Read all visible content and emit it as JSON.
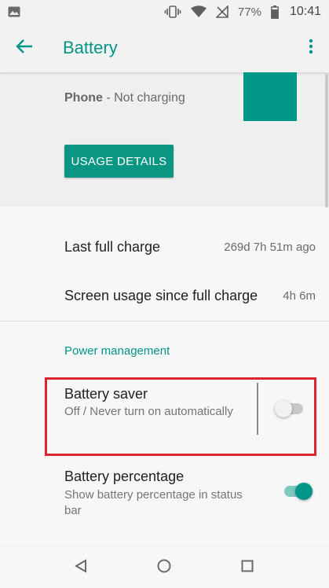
{
  "status_bar": {
    "battery_percent": "77%",
    "time": "10:41",
    "icons": [
      "image-icon",
      "vibrate-icon",
      "wifi-icon",
      "no-signal-icon",
      "battery-icon"
    ]
  },
  "app_bar": {
    "title": "Battery",
    "back_icon": "arrow-left-icon",
    "menu_icon": "more-vert-icon"
  },
  "header": {
    "device_name": "Phone",
    "device_status": " - Not charging",
    "usage_button_label": "USAGE DETAILS",
    "accent_block_color": "#009688"
  },
  "stats": [
    {
      "label": "Last full charge",
      "value": "269d 7h 51m ago"
    },
    {
      "label": "Screen usage since full charge",
      "value": "4h 6m"
    }
  ],
  "power_management": {
    "section_title": "Power management",
    "battery_saver": {
      "title": "Battery saver",
      "subtitle": "Off / Never turn on automatically",
      "enabled": false
    },
    "battery_percentage": {
      "title": "Battery percentage",
      "subtitle": "Show battery percentage in status bar",
      "enabled": true
    }
  },
  "colors": {
    "accent": "#009688",
    "highlight_border": "#e0242d"
  },
  "nav_bar": {
    "icons": [
      "back-triangle-icon",
      "home-circle-icon",
      "recents-square-icon"
    ]
  }
}
